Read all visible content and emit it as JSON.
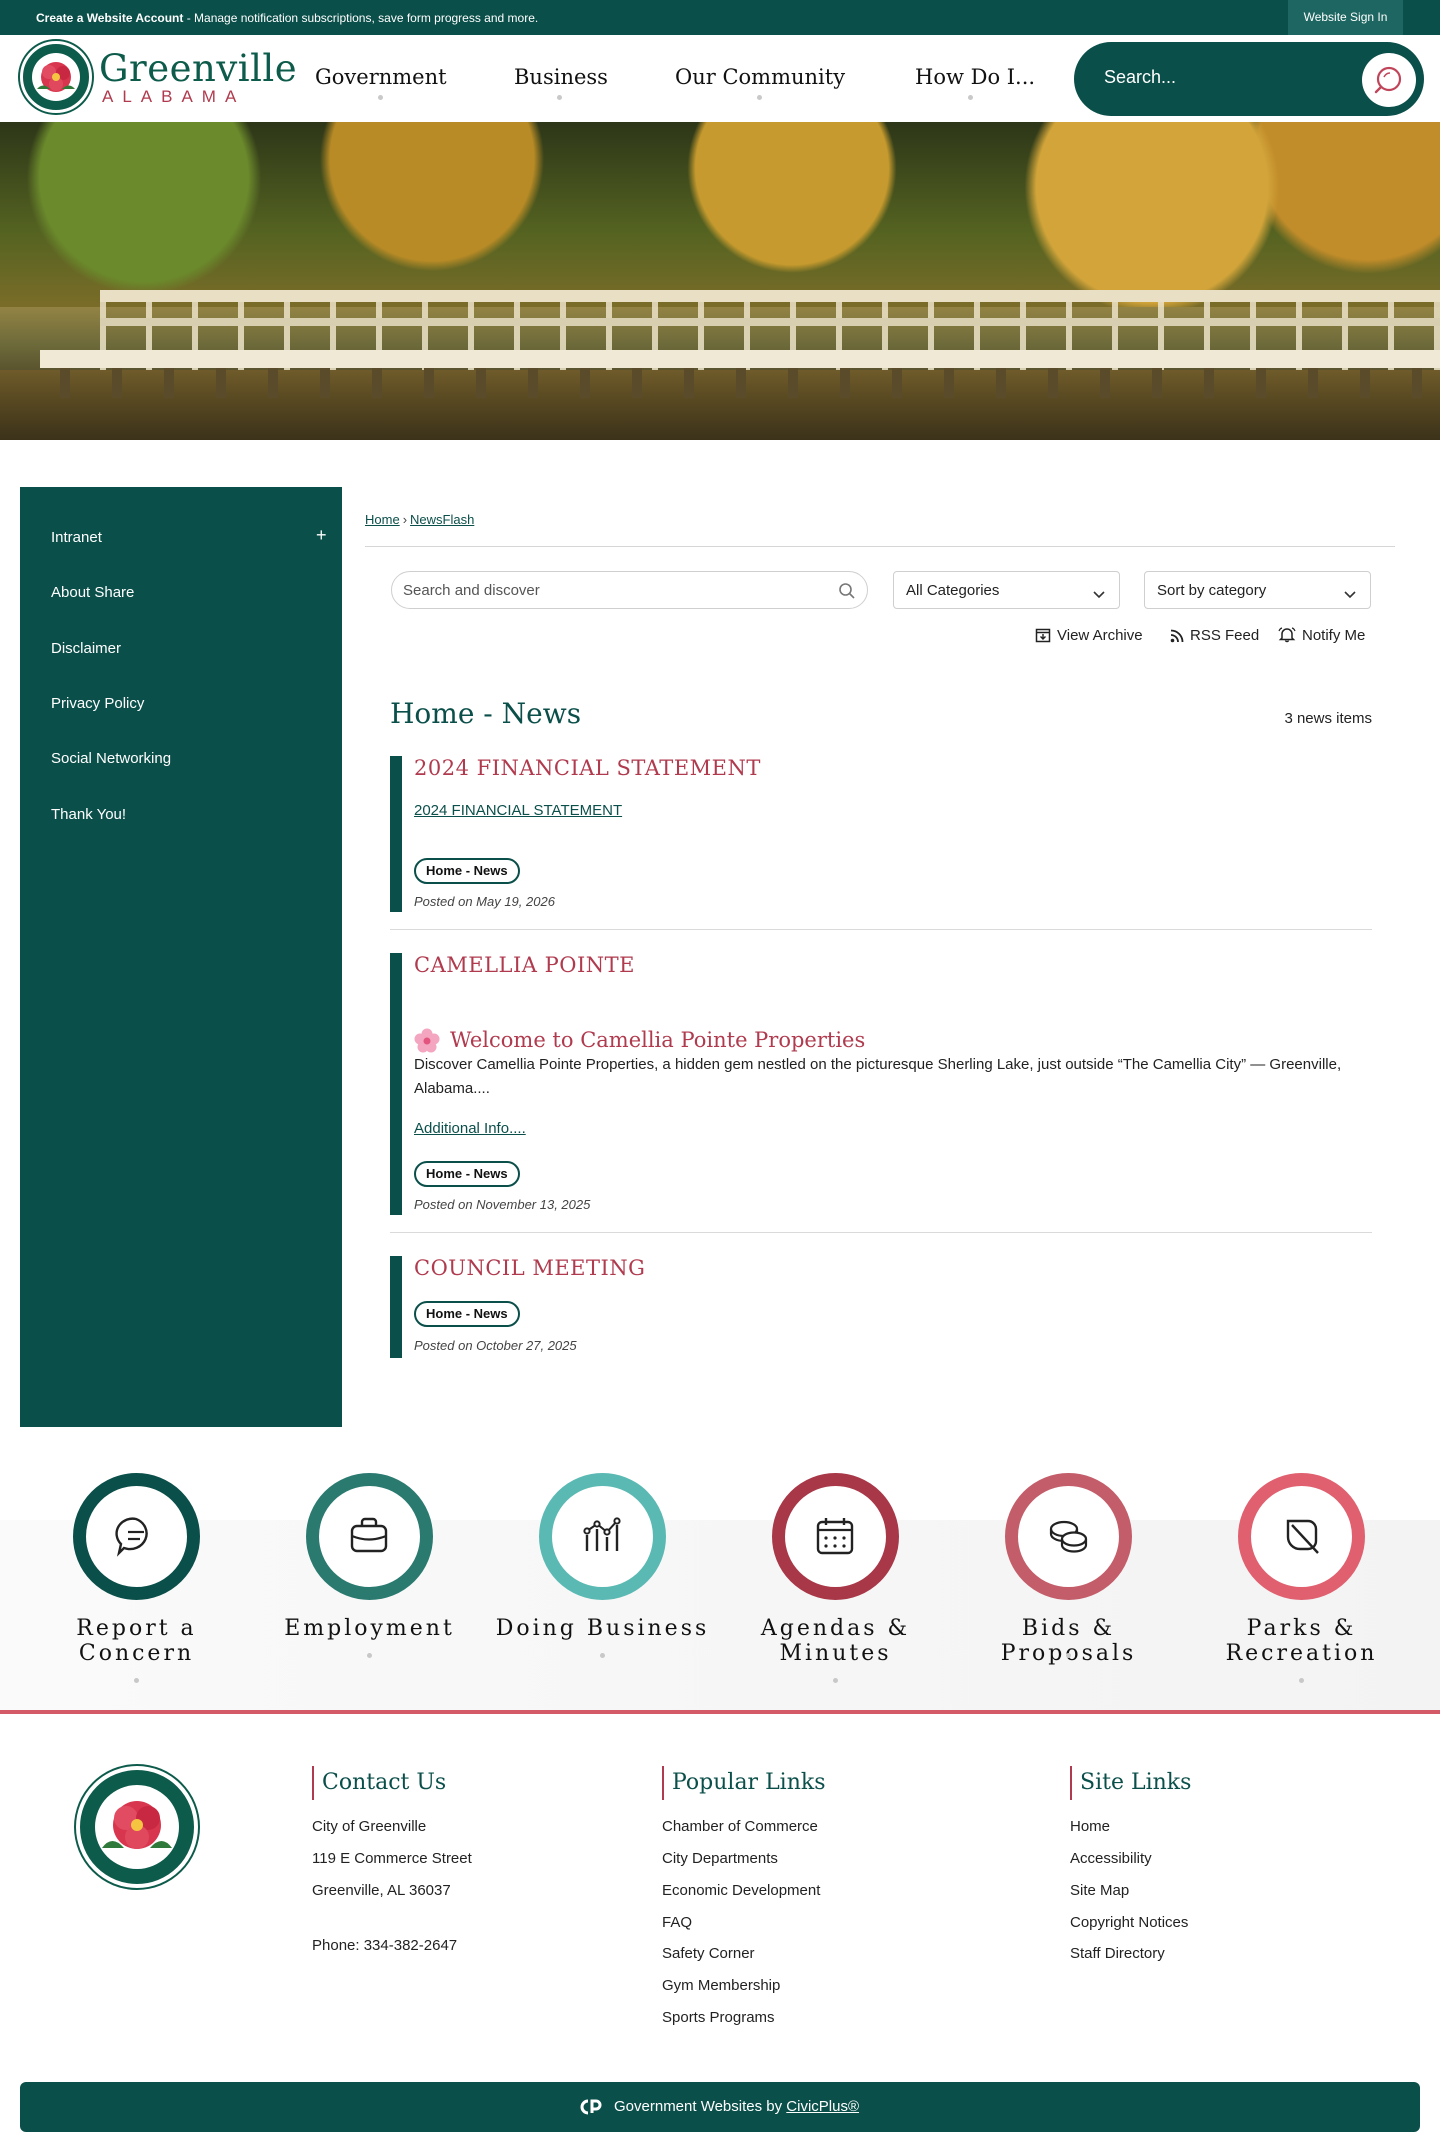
{
  "topbar": {
    "create_account": "Create a Website Account",
    "create_account_desc": " - Manage notification subscriptions, save form progress and more.",
    "sign_in": "Website Sign In"
  },
  "header": {
    "logo_title": "Greenville",
    "logo_sub": "ALABAMA",
    "nav": [
      "Government",
      "Business",
      "Our Community",
      "How Do I..."
    ],
    "search_placeholder": "Search..."
  },
  "sidebar": {
    "items": [
      "Intranet",
      "About Share",
      "Disclaimer",
      "Privacy Policy",
      "Social Networking",
      "Thank You!"
    ],
    "expand": "+"
  },
  "breadcrumb": {
    "home": "Home",
    "sep": "›",
    "current": "NewsFlash"
  },
  "filters": {
    "search_placeholder": "Search and discover",
    "category": "All Categories",
    "sort": "Sort by category"
  },
  "tools": {
    "archive": "View Archive",
    "rss": "RSS Feed",
    "notify": "Notify Me"
  },
  "section": {
    "title": "Home - News",
    "count": "3 news items"
  },
  "news": [
    {
      "title": "2024 FINANCIAL STATEMENT",
      "link": "2024 FINANCIAL STATEMENT",
      "tag": "Home - News",
      "posted": "Posted on May 19, 2026"
    },
    {
      "title": "CAMELLIA POINTE",
      "subhead": "Welcome to Camellia Pointe Properties",
      "body": "Discover Camellia Pointe Properties, a hidden gem nestled on the picturesque Sherling Lake, just outside “The Camellia City” — Greenville, Alabama....",
      "link": "Additional Info....",
      "tag": "Home - News",
      "posted": "Posted on November 13, 2025"
    },
    {
      "title": "COUNCIL MEETING",
      "tag": "Home - News",
      "posted": "Posted on October 27, 2025"
    }
  ],
  "quick_links": [
    {
      "line1": "Report a",
      "line2": "Concern",
      "icon": "chat-bubble-icon",
      "color": "#0b4f4a"
    },
    {
      "line1": "Employment",
      "line2": "",
      "icon": "briefcase-icon",
      "color": "#2a7a70"
    },
    {
      "line1": "Doing Business",
      "line2": "",
      "icon": "graph-icon",
      "color": "#5bb9b3"
    },
    {
      "line1": "Agendas &",
      "line2": "Minutes",
      "icon": "calendar-icon",
      "color": "#a83848"
    },
    {
      "line1": "Bids & Proposals",
      "line2": "",
      "icon": "coins-icon",
      "color": "#c45d6a"
    },
    {
      "line1": "Parks &",
      "line2": "Recreation",
      "icon": "leaf-icon",
      "color": "#e0606f"
    }
  ],
  "footer": {
    "contact": {
      "title": "Contact Us",
      "lines": [
        "City of Greenville",
        "119 E Commerce Street",
        "Greenville, AL 36037"
      ],
      "phone": "Phone: 334-382-2647"
    },
    "popular": {
      "title": "Popular Links",
      "lines": [
        "Chamber of Commerce",
        "City Departments",
        "Economic Development",
        "FAQ",
        "Safety Corner",
        "Gym Membership",
        "Sports Programs"
      ]
    },
    "site": {
      "title": "Site Links",
      "lines": [
        "Home",
        "Accessibility",
        "Site Map",
        "Copyright Notices",
        "Staff Directory"
      ]
    },
    "credit_prefix": "Government Websites by ",
    "credit_link": "CivicPlus®"
  },
  "colors": {
    "brand": "#0b4f4a",
    "accent": "#b03a4e"
  }
}
